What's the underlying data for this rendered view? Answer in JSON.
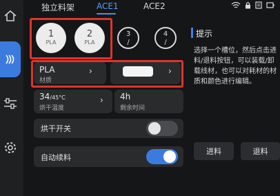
{
  "tabs": [
    {
      "label": "独立料架"
    },
    {
      "label": "ACE1"
    },
    {
      "label": "ACE2"
    }
  ],
  "slots": [
    {
      "number": "1",
      "material": "PLA"
    },
    {
      "number": "2",
      "material": "PLA"
    },
    {
      "number": "3",
      "material": "/"
    },
    {
      "number": "4",
      "material": "/"
    }
  ],
  "material_card": {
    "value": "PLA",
    "label": "材质"
  },
  "color_card": {
    "color": "#f4f4f4"
  },
  "drying_temp": {
    "value": "34",
    "unit": "/45°C",
    "label": "烘干温度"
  },
  "remaining_time": {
    "value": "4h",
    "label": "剩余时间"
  },
  "drying_switch": {
    "label": "烘干开关",
    "on": false
  },
  "auto_refill": {
    "label": "自动续料",
    "on": true
  },
  "tip": {
    "title": "提示",
    "body": "选择一个槽位，然后点击进料/退料按钮，可以装载/卸载线材，也可以对耗材的材质和颜色进行编辑。"
  },
  "buttons": {
    "load": "进料",
    "unload": "退料"
  },
  "colors": {
    "accent": "#3b7be0",
    "highlight": "#e0342c"
  }
}
